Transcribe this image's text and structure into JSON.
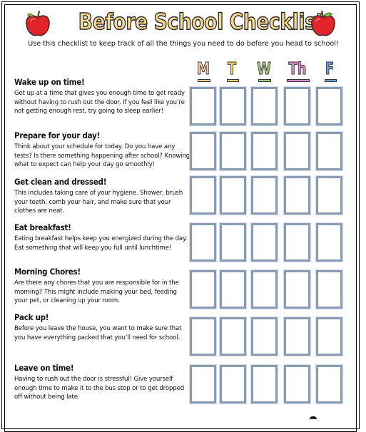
{
  "header": {
    "title": "Before School Checklist",
    "subtitle": "Use this checklist to keep track of all the things you need to do before you head to school!",
    "left_icon": "apple-icon",
    "right_icon": "apple-icon"
  },
  "days": [
    {
      "label": "M",
      "color": "#f7c9a8"
    },
    {
      "label": "T",
      "color": "#f8d75a"
    },
    {
      "label": "W",
      "color": "#a7c98a"
    },
    {
      "label": "Th",
      "color": "#e28ad0"
    },
    {
      "label": "F",
      "color": "#6fa3d8"
    }
  ],
  "tasks": [
    {
      "title": "Wake up on time!",
      "description": "Get up at a time that gives you enough time to get ready without having to rush out the door.  If you feel like you’re not getting enough rest, try going to sleep earlier!"
    },
    {
      "title": "Prepare for your day!",
      "description": "Think about your schedule for today.  Do you have any tests?  Is there something happening after school? Knowing what to expect can help your day go smoothly!"
    },
    {
      "title": "Get clean and dressed!",
      "description": "This includes taking care of your hygiene.  Shower, brush your teeth, comb your hair, and make sure that your clothes are neat."
    },
    {
      "title": "Eat breakfast!",
      "description": "Eating breakfast helps keep you energized during the day.  Eat something that will keep you full until lunchtime!"
    },
    {
      "title": "Morning Chores!",
      "description": "Are there any chores that you are responsible for in the morning?  This might include making your bed, feeding your pet, or cleaning up your room."
    },
    {
      "title": "Pack up!",
      "description": "Before you leave the house, you want to make sure that you have everything packed that you’ll need for school."
    },
    {
      "title": "Leave on time!",
      "description": "Having to rush out the door is stressful! Give yourself enough time to make it to the bus stop or to get dropped off without being late."
    }
  ],
  "checkbox_color": "#8a9bb4"
}
